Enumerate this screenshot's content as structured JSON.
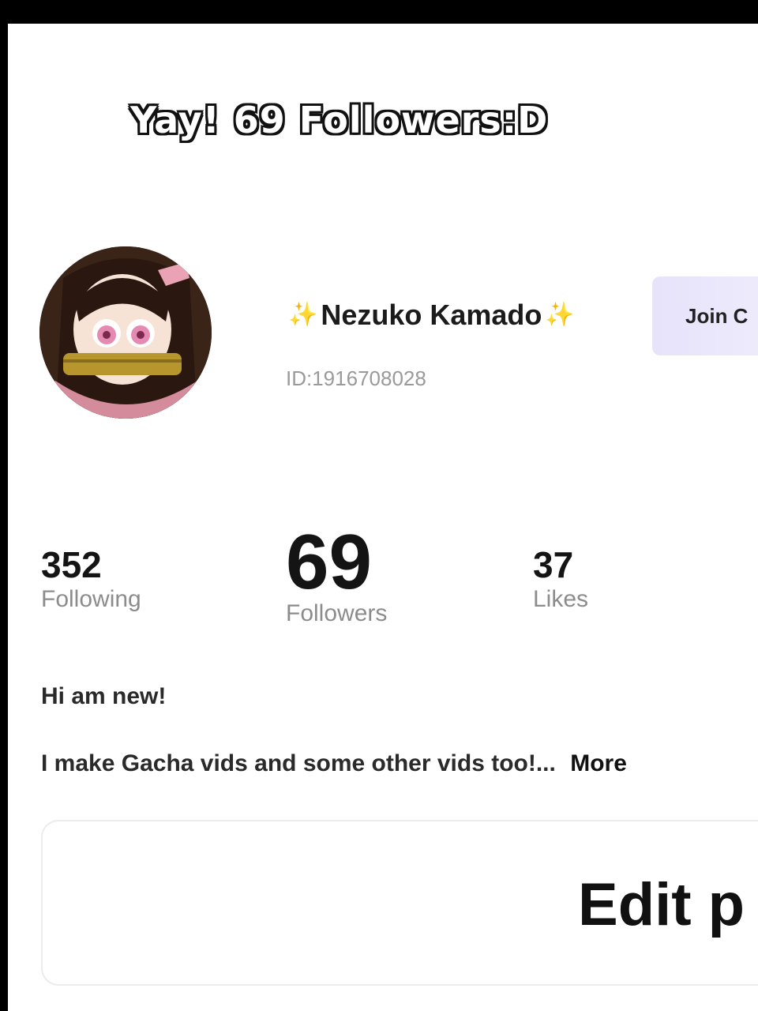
{
  "caption": "Yay! 69 Followers:D",
  "profile": {
    "name": "Nezuko Kamado",
    "sparkle": "✨",
    "id_text": "ID:1916708028",
    "join_button": "Join C"
  },
  "stats": {
    "following": {
      "value": "352",
      "label": "Following"
    },
    "followers": {
      "value": "69",
      "label": "Followers"
    },
    "likes": {
      "value": "37",
      "label": "Likes"
    }
  },
  "bio": {
    "line1": "Hi am new!",
    "line2": "I make Gacha vids and some other vids too!...",
    "more": "More"
  },
  "edit_button": "Edit p",
  "colors": {
    "accent_gradient": "#e6e3fb",
    "text": "#141414",
    "muted": "#8c8c8c",
    "sparkle": "#f4c430"
  }
}
